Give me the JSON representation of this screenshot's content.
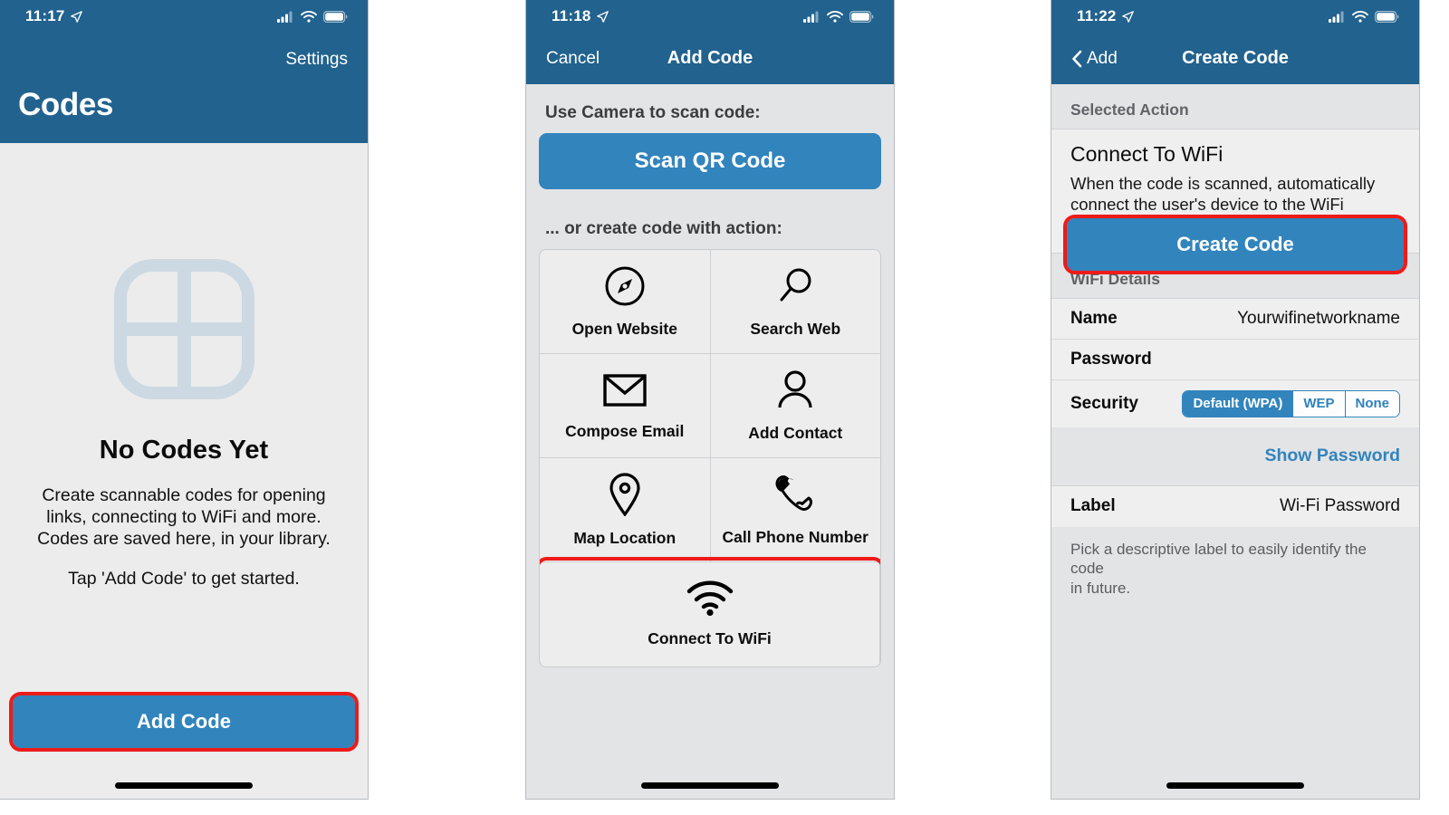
{
  "screens": [
    {
      "id": "codes-library",
      "status": {
        "time": "11:17",
        "location_icon": "location-arrow-icon",
        "cellular_icon": "cellular-signal-icon",
        "wifi_icon": "wifi-status-icon",
        "battery_icon": "battery-icon"
      },
      "nav": {
        "settings_label": "Settings",
        "title": "Codes"
      },
      "empty": {
        "icon": "grid-squares-icon",
        "title": "No Codes Yet",
        "line1": "Create scannable codes for opening",
        "line2": "links, connecting to WiFi and more.",
        "line3": "Codes are saved here, in your library.",
        "line4": "Tap 'Add Code' to get started."
      },
      "primary_button": {
        "label": "Add Code",
        "highlighted": true
      }
    },
    {
      "id": "add-code",
      "status": {
        "time": "11:18"
      },
      "nav": {
        "left_label": "Cancel",
        "title": "Add Code"
      },
      "scan_section": {
        "label": "Use Camera to scan code:",
        "button_label": "Scan QR Code"
      },
      "actions_section": {
        "label": "... or create code with action:",
        "items": [
          {
            "label": "Open Website",
            "icon": "compass-icon",
            "highlighted": false
          },
          {
            "label": "Search Web",
            "icon": "magnifier-icon",
            "highlighted": false
          },
          {
            "label": "Compose Email",
            "icon": "envelope-icon",
            "highlighted": false
          },
          {
            "label": "Add Contact",
            "icon": "person-icon",
            "highlighted": false
          },
          {
            "label": "Map Location",
            "icon": "map-pin-icon",
            "highlighted": false
          },
          {
            "label": "Call Phone Number",
            "icon": "phone-handset-icon",
            "highlighted": false
          },
          {
            "label": "Connect To WiFi",
            "icon": "wifi-icon",
            "highlighted": true
          }
        ]
      }
    },
    {
      "id": "create-code",
      "status": {
        "time": "11:22"
      },
      "nav": {
        "back_label": "Add",
        "title": "Create Code"
      },
      "selected_action": {
        "group_header": "Selected Action",
        "title": "Connect To WiFi",
        "desc_line1": "When the code is scanned, automatically",
        "desc_line2": "connect the user's device to the WiFi network."
      },
      "wifi_details": {
        "group_header": "WiFi Details",
        "name_label": "Name",
        "name_value": "Yourwifinetworkname",
        "password_label": "Password",
        "password_value": "",
        "security_label": "Security",
        "security_options": [
          "Default (WPA)",
          "WEP",
          "None"
        ],
        "security_selected": "Default (WPA)",
        "show_password_label": "Show Password"
      },
      "label_section": {
        "label": "Label",
        "value": "Wi-Fi Password",
        "footnote_line1": "Pick a descriptive label to easily identify the code",
        "footnote_line2": "in future."
      },
      "primary_button": {
        "label": "Create Code",
        "highlighted": true
      }
    }
  ],
  "colors": {
    "nav_blue": "#22628e",
    "button_blue": "#3284bd",
    "highlight_red": "#ee1b19",
    "page_gray": "#e3e4e6",
    "empty_icon_gray": "#ccd9e3"
  }
}
